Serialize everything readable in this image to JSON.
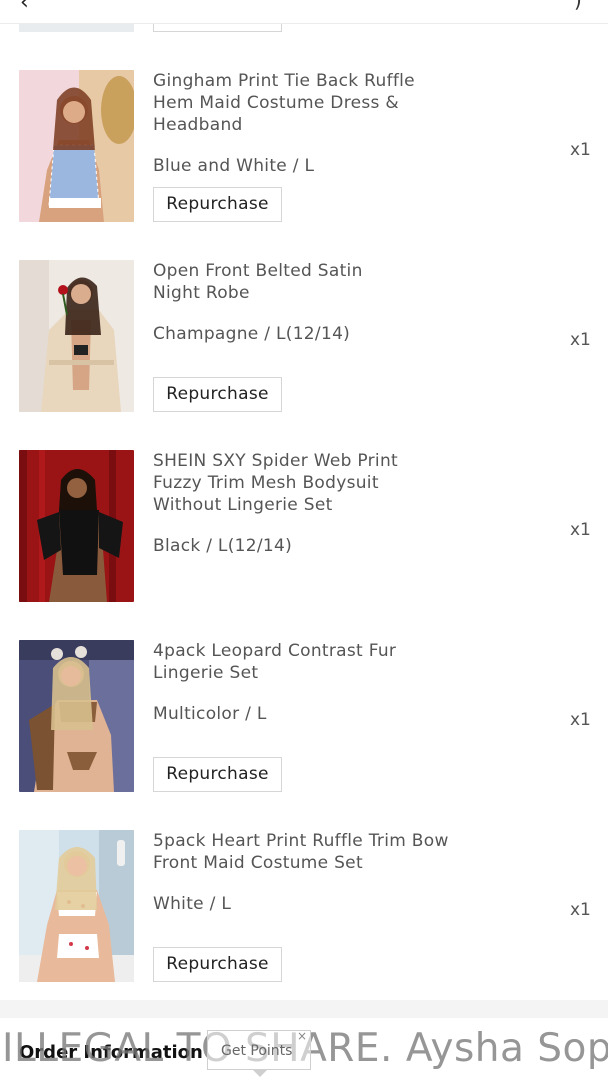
{
  "items": [
    {
      "name_lines": [
        "Gingham Print Tie Back Ruffle",
        "Hem Maid Costume Dress &",
        "Headband"
      ],
      "variant": "Blue and White / L",
      "qty": "x1",
      "button": "Repurchase",
      "image_icon": "product-photo",
      "palette": {
        "bg": "#f2d7dd",
        "accent": "#9bb7e0",
        "skin": "#d9a27e",
        "hair": "#7a3a1f"
      }
    },
    {
      "name_lines": [
        "Open Front Belted Satin",
        "Night Robe"
      ],
      "variant": "Champagne / L(12/14)",
      "qty": "x1",
      "button": "Repurchase",
      "image_icon": "product-photo",
      "palette": {
        "bg": "#efe9e4",
        "accent": "#e8d6bd",
        "skin": "#d6a585",
        "hair": "#3a2418"
      }
    },
    {
      "name_lines": [
        "SHEIN SXY Spider Web Print",
        "Fuzzy Trim Mesh Bodysuit",
        "Without Lingerie Set"
      ],
      "variant": "Black / L(12/14)",
      "qty": "x1",
      "button": null,
      "image_icon": "product-photo",
      "palette": {
        "bg": "#9a1416",
        "accent": "#111111",
        "skin": "#8a5a3c",
        "hair": "#1c1008"
      }
    },
    {
      "name_lines": [
        "4pack Leopard Contrast Fur",
        "Lingerie Set"
      ],
      "variant": "Multicolor / L",
      "qty": "x1",
      "button": "Repurchase",
      "image_icon": "product-photo",
      "palette": {
        "bg": "#4b4e78",
        "accent": "#8a5e3a",
        "skin": "#e0b394",
        "hair": "#d8c08e"
      }
    },
    {
      "name_lines": [
        "5pack Heart Print Ruffle Trim Bow",
        "Front Maid Costume Set"
      ],
      "variant": "White / L",
      "qty": "x1",
      "button": "Repurchase",
      "image_icon": "product-photo",
      "palette": {
        "bg": "#cfe0ea",
        "accent": "#ffffff",
        "skin": "#e8b99a",
        "hair": "#e2cc9a"
      }
    }
  ],
  "order_info_title": "Order Information",
  "watermark_text": "ILLEGAL TO SHARE. Aysha Sope",
  "get_points_label": "Get Points",
  "get_points_close": "×"
}
